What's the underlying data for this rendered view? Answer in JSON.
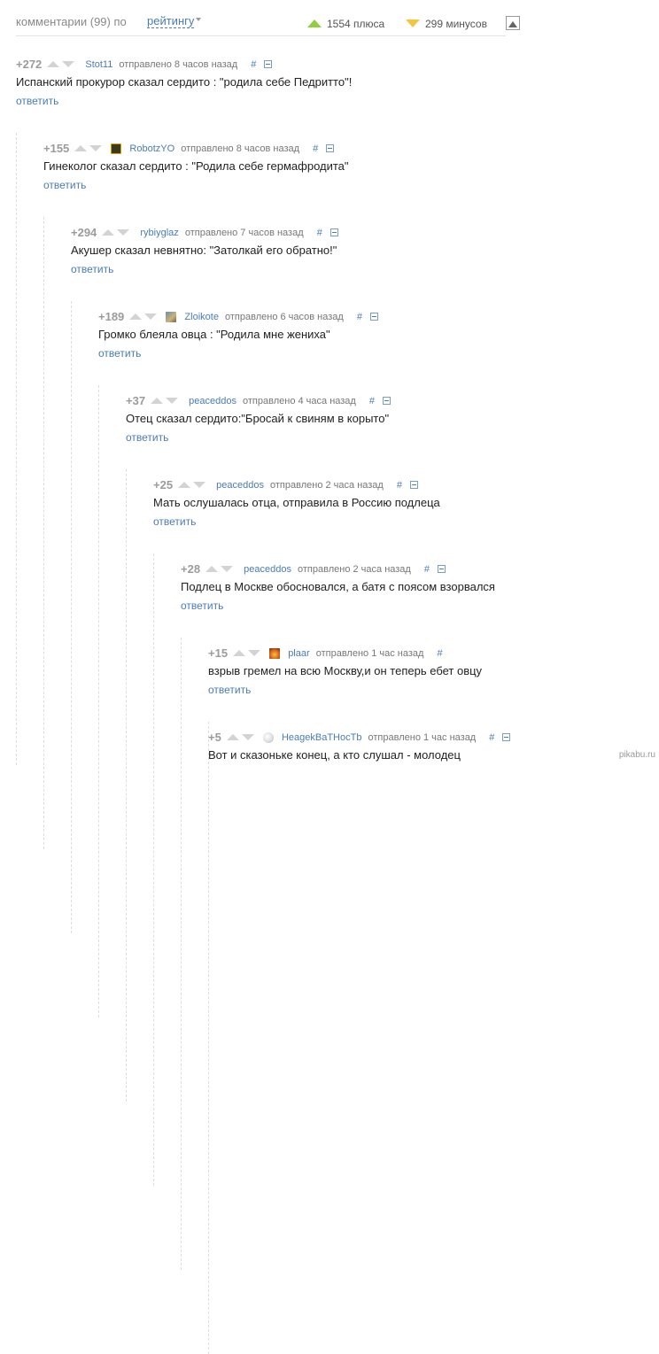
{
  "header": {
    "comments_count": "комментарии (99) по",
    "sort_label": "рейтингу",
    "plus_count": "1554 плюса",
    "minus_count": "299 минусов",
    "colors": {
      "plus": "#8fcf3c",
      "minus": "#f2c542",
      "link": "#4a7bb7"
    }
  },
  "reply_label": "ответить",
  "hash_label": "#",
  "comments": [
    {
      "rating": "+272",
      "author": "Stot11",
      "posted": "отправлено 8 часов назад",
      "text": "Испанский прокурор сказал сердито : \"родила себе Педритто\"!",
      "avatar": ""
    },
    {
      "rating": "+155",
      "author": "RobotzYO",
      "posted": "отправлено 8 часов назад",
      "text": "Гинеколог сказал сердито : \"Родила себе гермафродита\"",
      "avatar": "robot-avatar"
    },
    {
      "rating": "+294",
      "author": "rybiyglaz",
      "posted": "отправлено 7 часов назад",
      "text": "Акушер сказал невнятно: \"Затолкай его обратно!\"",
      "avatar": ""
    },
    {
      "rating": "+189",
      "author": "Zloikote",
      "posted": "отправлено 6 часов назад",
      "text": "Громко блеяла овца : \"Родила мне жениха\"",
      "avatar": "cat-avatar"
    },
    {
      "rating": "+37",
      "author": "peaceddos",
      "posted": "отправлено 4 часа назад",
      "text": "Отец сказал сердито:\"Бросай к свиням в корыто\"",
      "avatar": ""
    },
    {
      "rating": "+25",
      "author": "peaceddos",
      "posted": "отправлено 2 часа назад",
      "text": "Мать ослушалась отца, отправила в Россию подлеца",
      "avatar": ""
    },
    {
      "rating": "+28",
      "author": "peaceddos",
      "posted": "отправлено 2 часа назад",
      "text": "Подлец в Москве обосновался, а батя с поясом взорвался",
      "avatar": ""
    },
    {
      "rating": "+15",
      "author": "plaar",
      "posted": "отправлено 1 час назад",
      "text": "взрыв гремел на всю Москву,и он теперь ебет овцу",
      "avatar": "fire-avatar"
    },
    {
      "rating": "+5",
      "author": "HeagekBaTHocTb",
      "posted": "отправлено 1 час назад",
      "text": "Вот и сказоньке конец, а кто слушал - молодец",
      "avatar": "ghost-avatar"
    }
  ],
  "watermark": "pikabu.ru"
}
